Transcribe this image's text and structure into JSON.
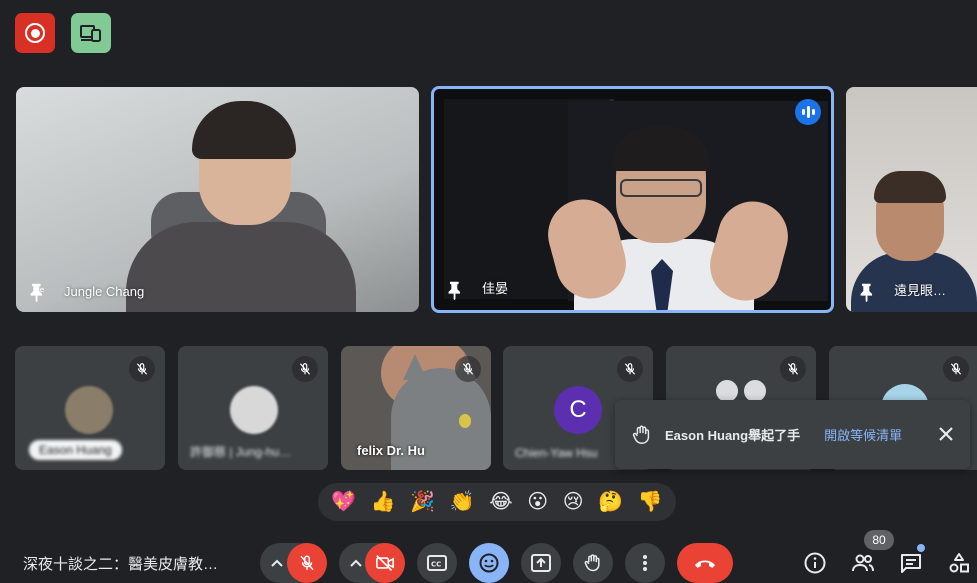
{
  "top_badges": {
    "recording_icon": "record-icon",
    "device_icon": "devices-icon"
  },
  "main_tiles": [
    {
      "name": "Jungle Chang",
      "pinned": true
    },
    {
      "name": "佳晏",
      "pinned": true,
      "speaking": true
    },
    {
      "name": "遠見眼…",
      "pinned": true
    }
  ],
  "small_tiles": [
    {
      "name": "Eason Huang",
      "muted": true,
      "blurred": true
    },
    {
      "name": "許御慈 | Jung-hu…",
      "muted": true,
      "blurred": true
    },
    {
      "name": "felix Dr. Hu",
      "muted": true,
      "blurred": false
    },
    {
      "name": "Chien-Yaw Hsu",
      "avatar_letter": "C",
      "muted": true,
      "blurred": true
    },
    {
      "name": "",
      "muted": true
    },
    {
      "name": "",
      "muted": true
    }
  ],
  "toast": {
    "message": "Eason Huang舉起了手",
    "link": "開啟等候清單"
  },
  "reactions": [
    "💖",
    "👍",
    "🎉",
    "👏",
    "😂",
    "😮",
    "😢",
    "🤔",
    "👎"
  ],
  "meeting_title": "深夜十談之二：醫美皮膚教…",
  "participants_count": "80",
  "colors": {
    "accent": "#8ab4f8",
    "danger": "#ea4335",
    "background": "#202124",
    "surface": "#3c4043"
  }
}
